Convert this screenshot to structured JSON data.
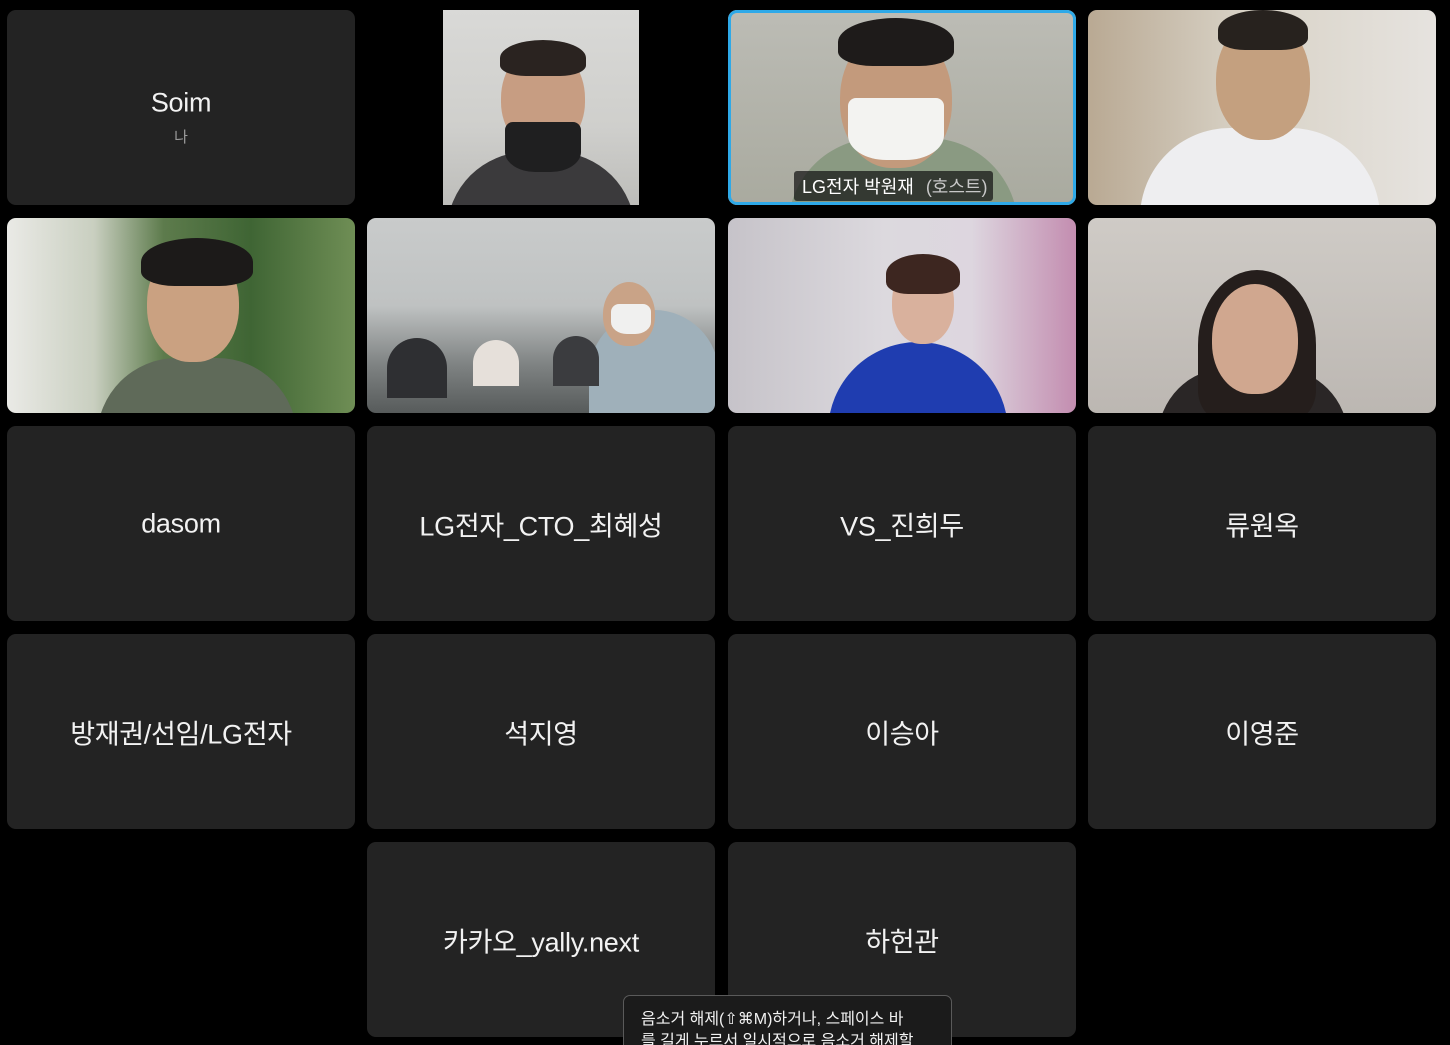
{
  "participants": {
    "self": {
      "name": "Soim",
      "label": "나"
    },
    "host": {
      "name": "LG전자 박원재",
      "role": "(호스트)"
    },
    "dasom": "dasom",
    "cto": "LG전자_CTO_최혜성",
    "vs": "VS_진희두",
    "ryu": "류원옥",
    "bang": "방재권/선임/LG전자",
    "seok": "석지영",
    "lee_seunga": "이승아",
    "lee_youngjun": "이영준",
    "kakao": "카카오_yally.next",
    "ha": "하헌관"
  },
  "tooltip": {
    "line1": "음소거 해제(⇧⌘M)하거나, 스페이스 바",
    "line2": "를 길게 누르서 일시적으로 음소거 해제할"
  },
  "colors": {
    "host_border": "#2ea9e8",
    "tile_bg": "#232323"
  }
}
